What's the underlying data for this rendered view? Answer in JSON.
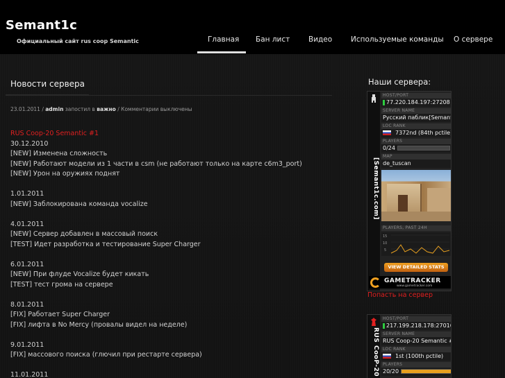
{
  "site": {
    "title": "Semant1c",
    "tagline": "Официальный сайт rus coop Semantic"
  },
  "nav": {
    "items": [
      "Главная",
      "Бан лист",
      "Видео",
      "Используемые команды",
      "О сервере"
    ],
    "active": "Главная"
  },
  "main": {
    "section_title": "Новости сервера",
    "meta": {
      "date": "23.01.2011",
      "sep1": " / ",
      "author": "admin",
      "posted_in": " запостил в ",
      "category": "важно",
      "comments": " / Комментарии выключены"
    },
    "post": {
      "title": "RUS Coop-20 Semantic #1",
      "lines": [
        "30.12.2010",
        "[NEW] Изменена сложность",
        "[NEW] Работают модели из 1 части в csm (не работают только на карте c6m3_port)",
        "[NEW] Урон на оружиях поднят",
        "",
        "1.01.2011",
        "[NEW] Заблокирована команда vocalize",
        "",
        "4.01.2011",
        "[NEW] Сервер добавлен в массовый поиск",
        "[TEST] Идет разработка и тестирование Super Charger",
        "",
        "6.01.2011",
        "[NEW] При флуде Vocalize будет кикать",
        "[TEST] тест грома на сервере",
        "",
        "8.01.2011",
        "[FIX] Работает Super Charger",
        "[FIX] лифта в No Mercy (провалы видел на неделе)",
        "",
        "9.01.2011",
        "[FIX] массового поиска (глючил при рестарте сервера)",
        "",
        "11.01.2011"
      ]
    }
  },
  "sidebar": {
    "title": "Наши сервера:",
    "join_link": "Попасть на сервер",
    "widget1": {
      "side_text": "[Semant1c.com]",
      "labels": {
        "host": "HOST/PORT",
        "name": "SERVER NAME",
        "loc": "LOC RANK",
        "players": "PLAYERS",
        "map": "MAP",
        "players_past": "PLAYERS, PAST 24H"
      },
      "host": "77.220.184.197:27208",
      "name": "Русский паблик[Semant1",
      "rank": "7372nd (84th pctile)",
      "players": "0/24",
      "players_fraction": 0.0,
      "map": "de_tuscan",
      "stats_button": "VIEW DETAILED STATS",
      "logo": "GAMETRACKER",
      "logo_sub": "www.gametracker.com"
    },
    "widget2": {
      "side_text": "RUS CooP-20 S",
      "labels": {
        "host": "HOST/PORT",
        "name": "SERVER NAME",
        "loc": "LOC RANK",
        "players": "PLAYERS"
      },
      "host": "217.199.218.178:27016",
      "name": "RUS Coop-20 Semantic #1",
      "rank": "1st (100th pctile)",
      "players": "20/20",
      "players_fraction": 1.0
    }
  },
  "colors": {
    "accent_red": "#e02020",
    "header_bg": "#000000",
    "body_bg": "#141414"
  }
}
